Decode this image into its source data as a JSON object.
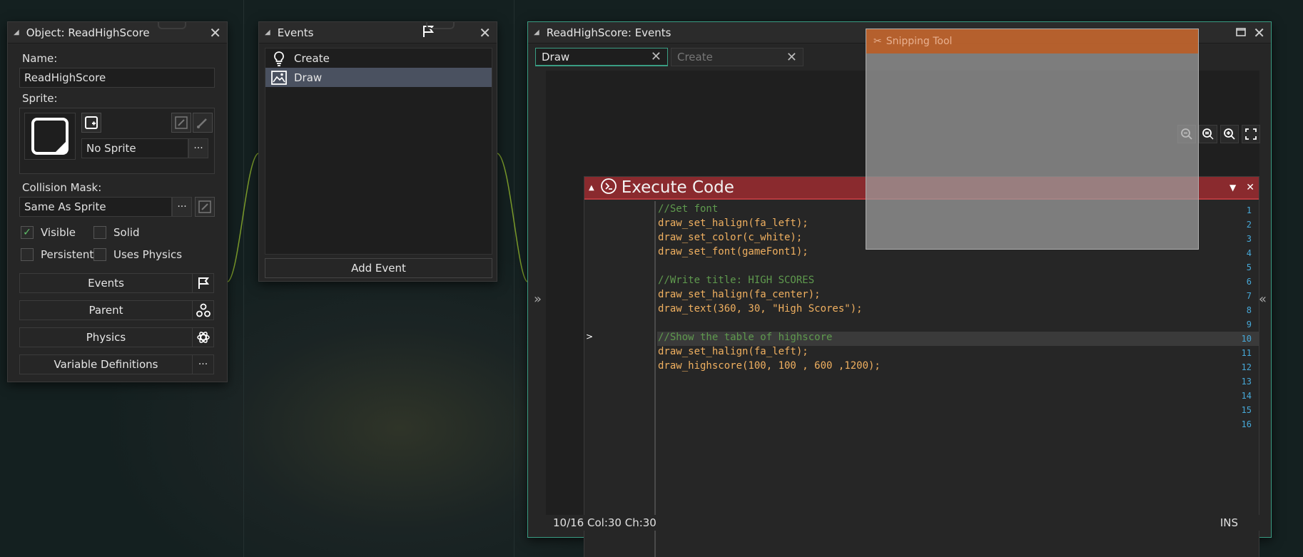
{
  "object_window": {
    "title": "Object: ReadHighScore",
    "name_label": "Name:",
    "name_value": "ReadHighScore",
    "sprite_label": "Sprite:",
    "sprite_value": "No Sprite",
    "collision_label": "Collision Mask:",
    "collision_value": "Same As Sprite",
    "dots": "···",
    "checkboxes": {
      "visible": {
        "label": "Visible",
        "checked": true
      },
      "solid": {
        "label": "Solid",
        "checked": false
      },
      "persistent": {
        "label": "Persistent",
        "checked": false
      },
      "uses_physics": {
        "label": "Uses Physics",
        "checked": false
      }
    },
    "buttons": {
      "events": "Events",
      "parent": "Parent",
      "physics": "Physics",
      "variable_definitions": "Variable Definitions"
    }
  },
  "events_window": {
    "title": "Events",
    "items": [
      {
        "label": "Create",
        "icon": "lightbulb-icon"
      },
      {
        "label": "Draw",
        "icon": "picture-icon"
      }
    ],
    "selected": "Draw",
    "add_event": "Add Event"
  },
  "editor_window": {
    "title": "ReadHighScore: Events",
    "tabs": [
      {
        "label": "Draw",
        "active": true
      },
      {
        "label": "Create",
        "active": false
      }
    ],
    "block_title": "Execute Code",
    "line_numbers": [
      "1",
      "2",
      "3",
      "4",
      "5",
      "6",
      "7",
      "8",
      "9",
      "10",
      "11",
      "12",
      "13",
      "14",
      "15",
      "16"
    ],
    "code": [
      "//Set font",
      "draw_set_halign(fa_left);",
      "draw_set_color(c_white);",
      "draw_set_font(gameFont1);",
      "",
      "//Write title: HIGH SCORES",
      "draw_set_halign(fa_center);",
      "draw_text(360, 30, \"High Scores\");",
      "",
      "//Show the table of highscore",
      "draw_set_halign(fa_left);",
      "draw_highscore(100, 100 , 600 ,1200);",
      "",
      "",
      "",
      ""
    ],
    "current_line": 10,
    "status_position": "10/16 Col:30 Ch:30",
    "status_mode": "INS"
  },
  "snipping_tool": {
    "title": "Snipping Tool"
  },
  "colors": {
    "accent": "#3a9d83",
    "code_block_header": "#8a2a2e",
    "selection": "#4a5160"
  }
}
